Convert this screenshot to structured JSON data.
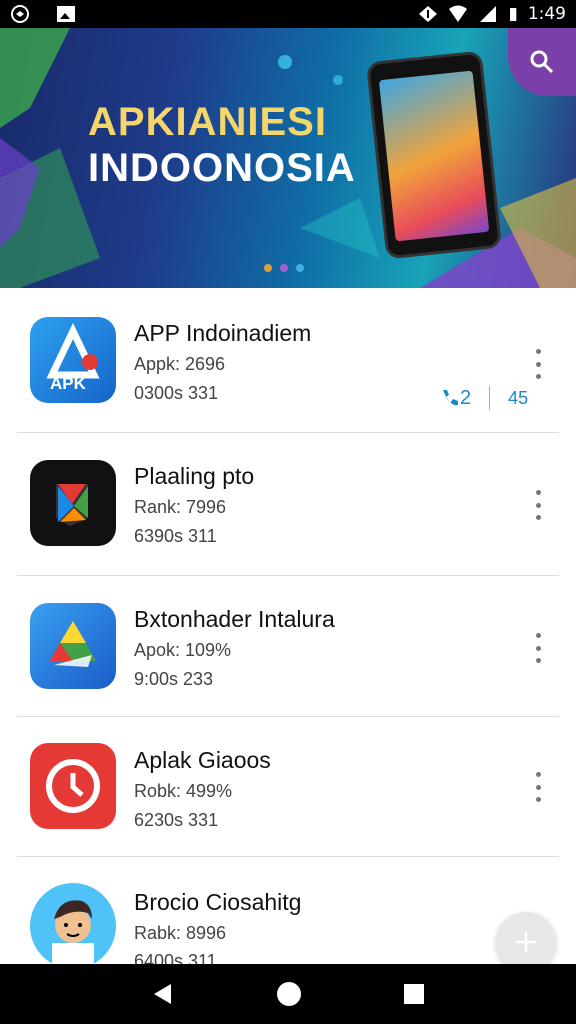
{
  "status_bar": {
    "time": "1:49",
    "battery": "▮"
  },
  "banner": {
    "line1": "APKIANIESI",
    "line2": "INDOONOSIA"
  },
  "apps": [
    {
      "name": "APP Indoinadiem",
      "meta1": "Appk: 2696",
      "meta2": "0300s 331",
      "icon": "apk-app-icon",
      "actions": {
        "left": "2",
        "right": "45"
      }
    },
    {
      "name": "Plaaling pto",
      "meta1": "Rank: 7996",
      "meta2": "6390s 311",
      "icon": "playing-app-icon"
    },
    {
      "name": "Bxtonhader Intalura",
      "meta1": "Apok: 109%",
      "meta2": "9:00s 233",
      "icon": "triangle-app-icon"
    },
    {
      "name": "Aplak Giaoos",
      "meta1": "Robk: 499%",
      "meta2": "6230s 331",
      "icon": "clock-app-icon"
    },
    {
      "name": "Brocio Ciosahitg",
      "meta1": "Rabk: 8996",
      "meta2": "6400s 311",
      "icon": "avatar-app-icon"
    }
  ],
  "colors": {
    "accent": "#1c88c9",
    "search_bg": "#7a3fa8"
  }
}
